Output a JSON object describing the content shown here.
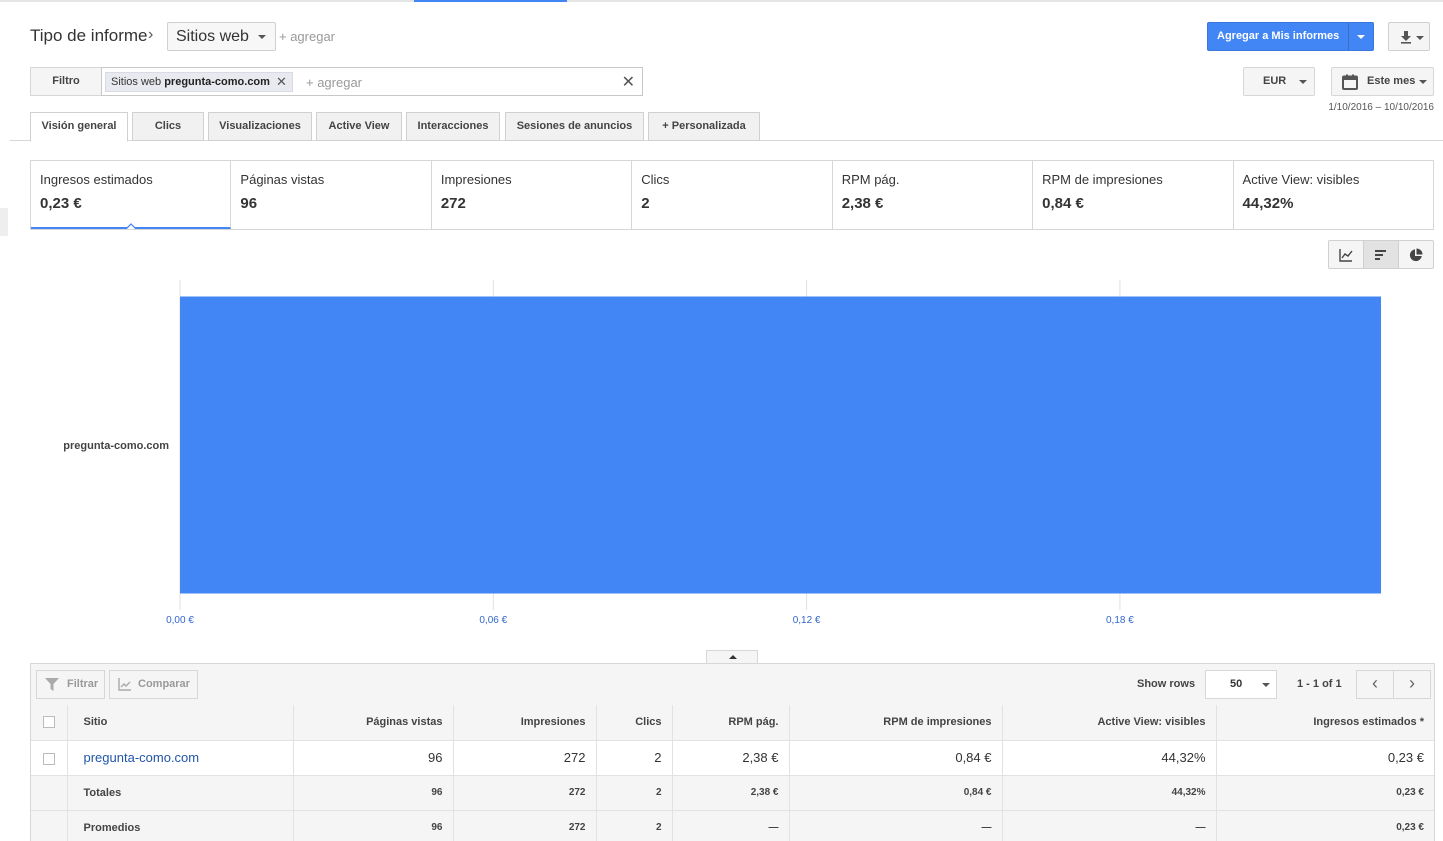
{
  "header": {
    "report_type_label": "Tipo de informe",
    "site_select": "Sitios web",
    "add_link": "+ agregar",
    "primary_button": "Agregar a Mis informes"
  },
  "filter": {
    "label": "Filtro",
    "chip_prefix": "Sitios web",
    "chip_value": "pregunta-como.com",
    "add_placeholder": "+ agregar",
    "currency": "EUR",
    "date_button": "Este mes",
    "date_range": "1/10/2016 – 10/10/2016"
  },
  "tabs": [
    {
      "label": "Visión general",
      "active": true
    },
    {
      "label": "Clics"
    },
    {
      "label": "Visualizaciones"
    },
    {
      "label": "Active View"
    },
    {
      "label": "Interacciones"
    },
    {
      "label": "Sesiones de anuncios"
    },
    {
      "label": "+  Personalizada"
    }
  ],
  "metrics": [
    {
      "label": "Ingresos estimados",
      "value": "0,23 €",
      "active": true
    },
    {
      "label": "Páginas vistas",
      "value": "96"
    },
    {
      "label": "Impresiones",
      "value": "272"
    },
    {
      "label": "Clics",
      "value": "2"
    },
    {
      "label": "RPM pág.",
      "value": "2,38 €"
    },
    {
      "label": "RPM de impresiones",
      "value": "0,84 €"
    },
    {
      "label": "Active View: visibles",
      "value": "44,32%"
    }
  ],
  "chart_data": {
    "type": "bar",
    "orientation": "horizontal",
    "categories": [
      "pregunta-como.com"
    ],
    "values": [
      0.23
    ],
    "xlim": [
      0,
      0.23
    ],
    "xticks": [
      0,
      0.06,
      0.12,
      0.18
    ],
    "xtick_labels": [
      "0,00 €",
      "0,06 €",
      "0,12 €",
      "0,18 €"
    ],
    "bar_color": "#4285f4",
    "grid": true,
    "title": "",
    "xlabel": "",
    "ylabel": ""
  },
  "table": {
    "toolbar": {
      "filter_button": "Filtrar",
      "compare_button": "Comparar",
      "show_rows_label": "Show rows",
      "rows_value": "50",
      "pager_text": "1 - 1 of 1",
      "prev": "‹",
      "next": "›"
    },
    "columns": [
      "Sitio",
      "Páginas vistas",
      "Impresiones",
      "Clics",
      "RPM pág.",
      "RPM de impresiones",
      "Active View: visibles",
      "Ingresos estimados *"
    ],
    "rows": [
      [
        "pregunta-como.com",
        "96",
        "272",
        "2",
        "2,38 €",
        "0,84 €",
        "44,32%",
        "0,23 €"
      ]
    ],
    "totals": [
      "Totales",
      "96",
      "272",
      "2",
      "2,38 €",
      "0,84 €",
      "44,32%",
      "0,23 €"
    ],
    "averages": [
      "Promedios",
      "96",
      "272",
      "2",
      "—",
      "—",
      "—",
      "0,23 €"
    ]
  }
}
